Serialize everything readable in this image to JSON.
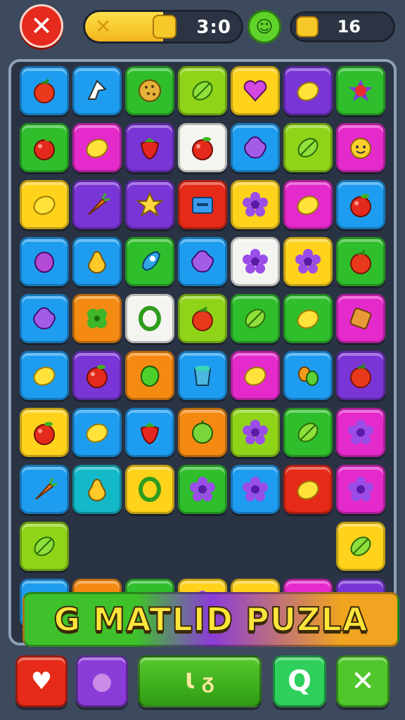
{
  "header": {
    "close_label": "✕",
    "score_icon_label": "✕",
    "score_text": "3:0",
    "score_progress": 0.5,
    "smiley_label": "☺",
    "coins_text": "16"
  },
  "banner": {
    "title": "G MATLID PUZLA"
  },
  "colors": {
    "red": "#e52a18",
    "orange": "#f58a12",
    "yellow": "#ffd21c",
    "lime": "#8fd419",
    "green": "#2fbf2c",
    "teal": "#13b8c9",
    "blue": "#1e9df0",
    "purple": "#7a35d6",
    "magenta": "#e52acb",
    "white": "#f4f4f0"
  },
  "grid": {
    "rows": [
      [
        [
          "blue",
          "tomato-icon"
        ],
        [
          "blue",
          "arrow-icon"
        ],
        [
          "green",
          "cookie-icon"
        ],
        [
          "lime",
          "leaf-icon"
        ],
        [
          "yellow",
          "heart-icon"
        ],
        [
          "purple",
          "lemon-icon"
        ],
        [
          "green",
          "star-berry-icon"
        ]
      ],
      [
        [
          "green",
          "apple-icon"
        ],
        [
          "magenta",
          "lemon-icon"
        ],
        [
          "purple",
          "strawberry-icon"
        ],
        [
          "white",
          "apple-icon"
        ],
        [
          "blue",
          "blob-icon"
        ],
        [
          "lime",
          "leaf-icon"
        ],
        [
          "magenta",
          "face-fruit-icon"
        ]
      ],
      [
        [
          "yellow",
          "lemon-icon"
        ],
        [
          "purple",
          "carrot-icon"
        ],
        [
          "purple",
          "star-fruit-icon"
        ],
        [
          "red",
          "square-icon"
        ],
        [
          "yellow",
          "flower-icon"
        ],
        [
          "magenta",
          "lemon-icon"
        ],
        [
          "blue",
          "apple-icon"
        ]
      ],
      [
        [
          "blue",
          "plum-icon"
        ],
        [
          "blue",
          "pear-icon"
        ],
        [
          "green",
          "rocket-icon"
        ],
        [
          "blue",
          "blob-icon"
        ],
        [
          "white",
          "flower-icon"
        ],
        [
          "yellow",
          "flower-icon"
        ],
        [
          "green",
          "tomato-icon"
        ]
      ],
      [
        [
          "blue",
          "blob-icon"
        ],
        [
          "orange",
          "clover-icon"
        ],
        [
          "white",
          "ring-icon"
        ],
        [
          "lime",
          "tomato-icon"
        ],
        [
          "green",
          "leaf-icon"
        ],
        [
          "green",
          "lemon-icon"
        ],
        [
          "magenta",
          "block-icon"
        ]
      ],
      [
        [
          "blue",
          "lemon-icon"
        ],
        [
          "purple",
          "apple-icon"
        ],
        [
          "orange",
          "pepper-icon"
        ],
        [
          "blue",
          "cup-icon"
        ],
        [
          "magenta",
          "lemon-icon"
        ],
        [
          "blue",
          "bean-icon"
        ],
        [
          "purple",
          "tomato-icon"
        ]
      ],
      [
        [
          "yellow",
          "apple-icon"
        ],
        [
          "blue",
          "lemon-icon"
        ],
        [
          "blue",
          "strawberry-icon"
        ],
        [
          "orange",
          "lime-fruit-icon"
        ],
        [
          "lime",
          "flower-icon"
        ],
        [
          "green",
          "leaf-icon"
        ],
        [
          "magenta",
          "flower-icon"
        ]
      ],
      [
        [
          "blue",
          "carrot-icon"
        ],
        [
          "teal",
          "pear-icon"
        ],
        [
          "yellow",
          "ring-icon"
        ],
        [
          "green",
          "flower-icon"
        ],
        [
          "blue",
          "flower-icon"
        ],
        [
          "red",
          "lemon-icon"
        ],
        [
          "magenta",
          "flower-icon"
        ]
      ],
      [
        [
          "lime",
          "leaf-icon"
        ],
        [
          "",
          "banner"
        ],
        [
          "",
          "banner"
        ],
        [
          "",
          "banner"
        ],
        [
          "",
          "banner"
        ],
        [
          "",
          "banner"
        ],
        [
          "yellow",
          "leaf-icon"
        ]
      ],
      [
        [
          "blue",
          "tomato-icon"
        ],
        [
          "orange",
          "cube-icon"
        ],
        [
          "green",
          "banana-icon"
        ],
        [
          "yellow",
          "flower-icon"
        ],
        [
          "yellow",
          "seed-icon"
        ],
        [
          "magenta",
          "face-fruit-icon"
        ],
        [
          "purple",
          "eyes-icon"
        ]
      ]
    ]
  },
  "bottom_bar": {
    "btn1_label": "♥",
    "btn2_label": "●",
    "btn3_label": "Ɩ  ᵹ",
    "btn4_label": "Q",
    "btn5_label": "✕"
  }
}
